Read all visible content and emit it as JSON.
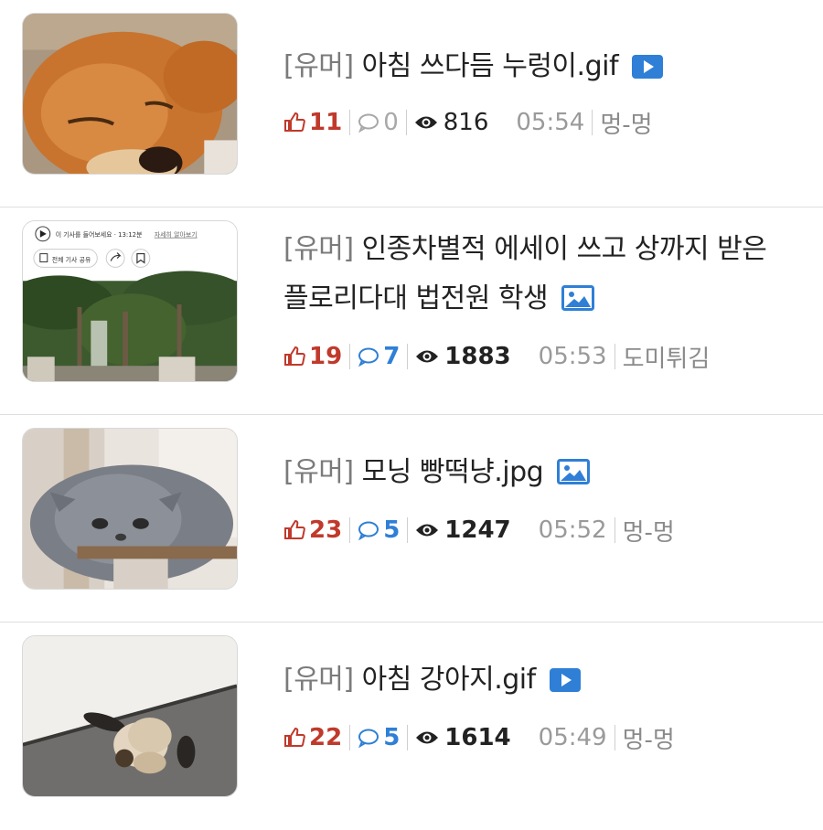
{
  "posts": [
    {
      "tag": "[유머]",
      "title": "아침 쓰다듬 누렁이.gif",
      "media_type": "video",
      "likes": "11",
      "comments": "0",
      "views": "816",
      "time": "05:54",
      "author": "멍-멍"
    },
    {
      "tag": "[유머]",
      "title": "인종차별적 에세이 쓰고 상까지 받은 플로리다대 법전원 학생",
      "media_type": "image",
      "likes": "19",
      "comments": "7",
      "views": "1883",
      "time": "05:53",
      "author": "도미튀김",
      "thumb_text": {
        "listen": "이 기사를 들어보세요 · 13:12분",
        "more": "자세히 알아보기",
        "share": "전체 기사 공유"
      }
    },
    {
      "tag": "[유머]",
      "title": "모닝 빵떡냥.jpg",
      "media_type": "image",
      "likes": "23",
      "comments": "5",
      "views": "1247",
      "time": "05:52",
      "author": "멍-멍"
    },
    {
      "tag": "[유머]",
      "title": "아침 강아지.gif",
      "media_type": "video",
      "likes": "22",
      "comments": "5",
      "views": "1614",
      "time": "05:49",
      "author": "멍-멍"
    }
  ],
  "colors": {
    "like": "#c0392b",
    "comment": "#2f7fd6",
    "tag": "#7b7b7b",
    "media_icon": "#2f7fd6"
  },
  "icons": {
    "like": "thumbs-up-icon",
    "comment": "speech-bubble-icon",
    "views": "eye-icon",
    "video": "play-icon",
    "image": "image-icon"
  }
}
